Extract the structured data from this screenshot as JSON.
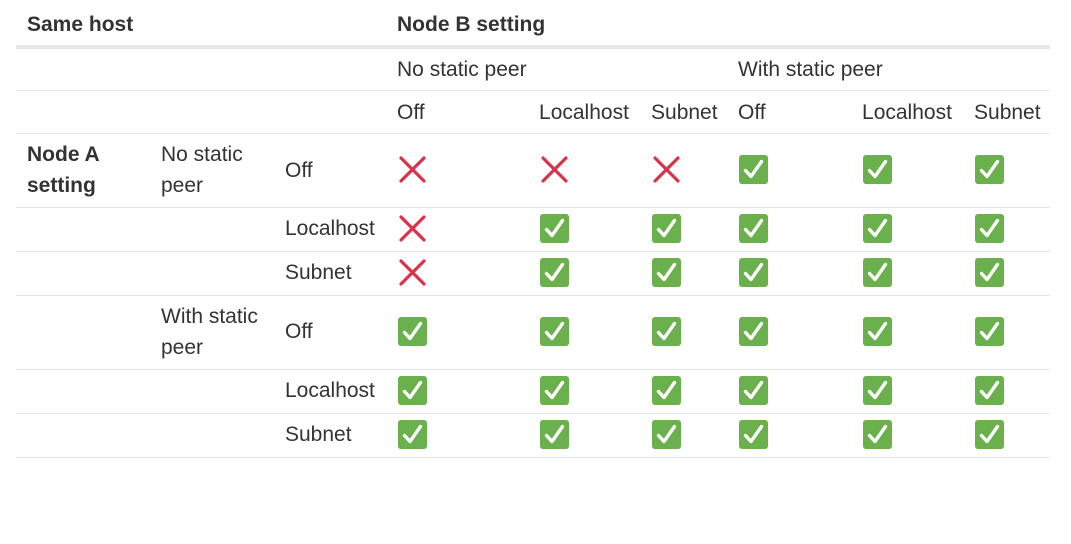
{
  "header": {
    "corner": "Same host",
    "nodeb": "Node B setting"
  },
  "nodeb_groups": [
    "No static peer",
    "With static peer"
  ],
  "nodeb_modes": [
    "Off",
    "Localhost",
    "Subnet",
    "Off",
    "Localhost",
    "Subnet"
  ],
  "nodea_label": "Node A setting",
  "nodea_groups": [
    "No static peer",
    "With static peer"
  ],
  "nodea_modes": [
    "Off",
    "Localhost",
    "Subnet",
    "Off",
    "Localhost",
    "Subnet"
  ],
  "marks": {
    "yes_icon": "check-box-icon",
    "no_icon": "cross-icon",
    "yes_color": "#6ab04c",
    "no_color": "#d9324a"
  },
  "matrix": [
    [
      "no",
      "no",
      "no",
      "yes",
      "yes",
      "yes"
    ],
    [
      "no",
      "yes",
      "yes",
      "yes",
      "yes",
      "yes"
    ],
    [
      "no",
      "yes",
      "yes",
      "yes",
      "yes",
      "yes"
    ],
    [
      "yes",
      "yes",
      "yes",
      "yes",
      "yes",
      "yes"
    ],
    [
      "yes",
      "yes",
      "yes",
      "yes",
      "yes",
      "yes"
    ],
    [
      "yes",
      "yes",
      "yes",
      "yes",
      "yes",
      "yes"
    ]
  ]
}
